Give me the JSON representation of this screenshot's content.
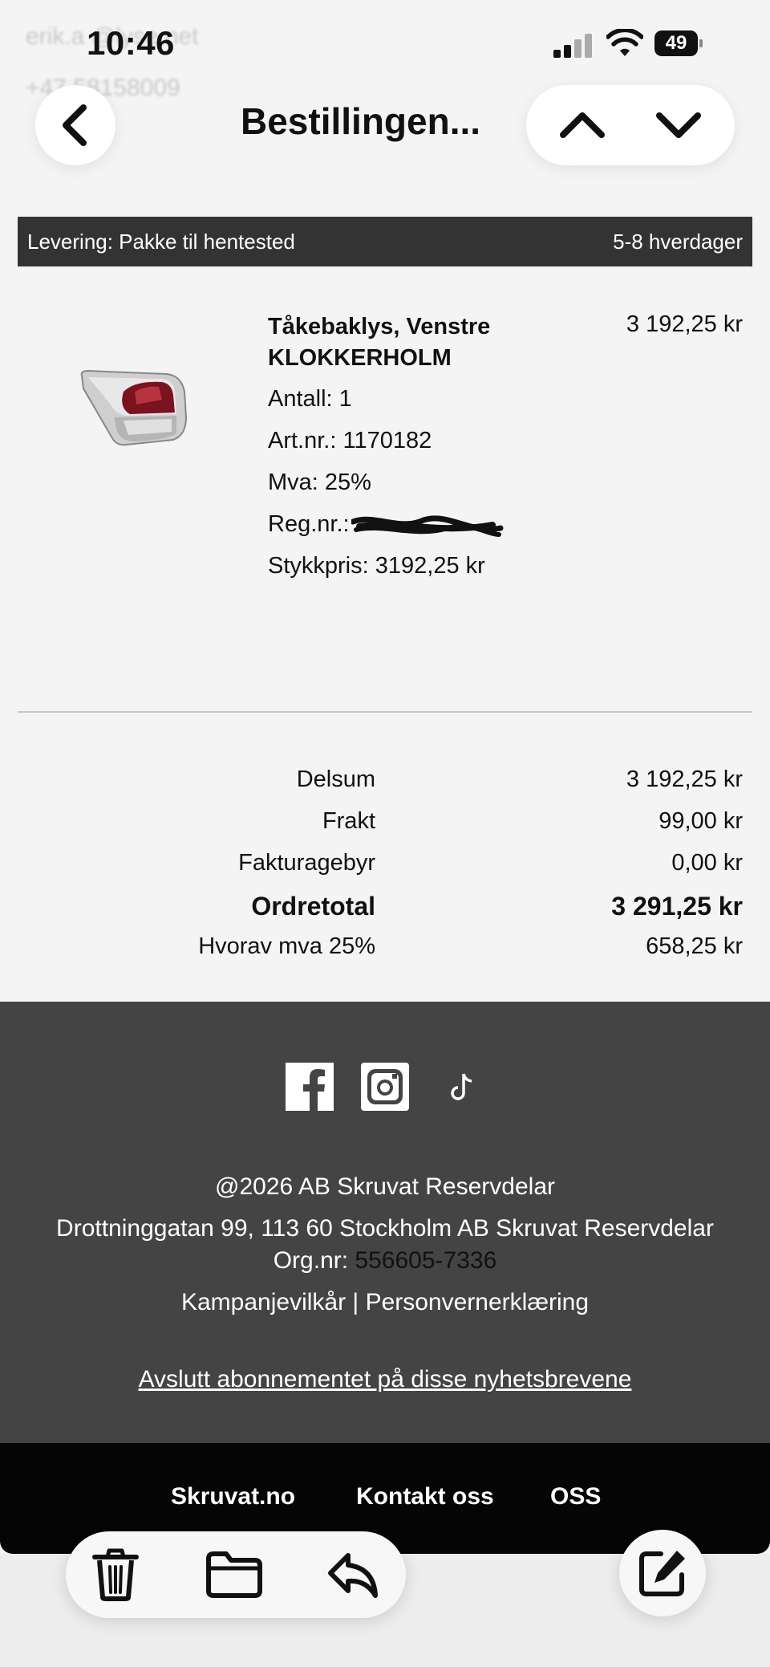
{
  "status_bar": {
    "time": "10:46",
    "battery": "49"
  },
  "underlay": {
    "line1": "erik.a      @lyse.net",
    "line2": "+47 58158009"
  },
  "nav": {
    "title": "Bestillingen..."
  },
  "delivery": {
    "label": "Levering: Pakke til hentested",
    "time": "5-8 hverdager"
  },
  "product": {
    "name": "Tåkebaklys, Venstre KLOKKERHOLM",
    "quantity": "Antall: 1",
    "art_nr": "Art.nr.: 1170182",
    "vat": "Mva: 25%",
    "reg_label": "Reg.nr.:",
    "unit_price": "Stykkpris: 3192,25 kr",
    "price": "3 192,25 kr"
  },
  "totals": [
    {
      "label": "Delsum",
      "value": "3 192,25 kr"
    },
    {
      "label": "Frakt",
      "value": "99,00 kr"
    },
    {
      "label": "Fakturagebyr",
      "value": "0,00 kr"
    },
    {
      "label": "Ordretotal",
      "value": "3 291,25 kr"
    },
    {
      "label": "Hvorav mva 25%",
      "value": "658,25 kr"
    }
  ],
  "footer": {
    "copyright": "@2026 AB Skruvat Reservdelar",
    "address": "Drottninggatan 99, 113 60 Stockholm AB Skruvat Reservdelar",
    "org_label": "Org.nr:",
    "org_number": "556605-7336",
    "campaign_terms": "Kampanjevilkår",
    "separator": "|",
    "privacy": "Personvernerklæring",
    "unsubscribe": "Avslutt abonnementet på disse nyhetsbrevene"
  },
  "bottom_links": {
    "site": "Skruvat.no",
    "contact": "Kontakt oss",
    "faq": "OSS"
  },
  "icons": {
    "back": "chevron-left-icon",
    "up": "chevron-up-icon",
    "down": "chevron-down-icon",
    "facebook": "facebook-icon",
    "instagram": "instagram-icon",
    "tiktok": "tiktok-icon",
    "trash": "trash-icon",
    "folder": "folder-icon",
    "reply": "reply-icon",
    "compose": "compose-icon"
  }
}
